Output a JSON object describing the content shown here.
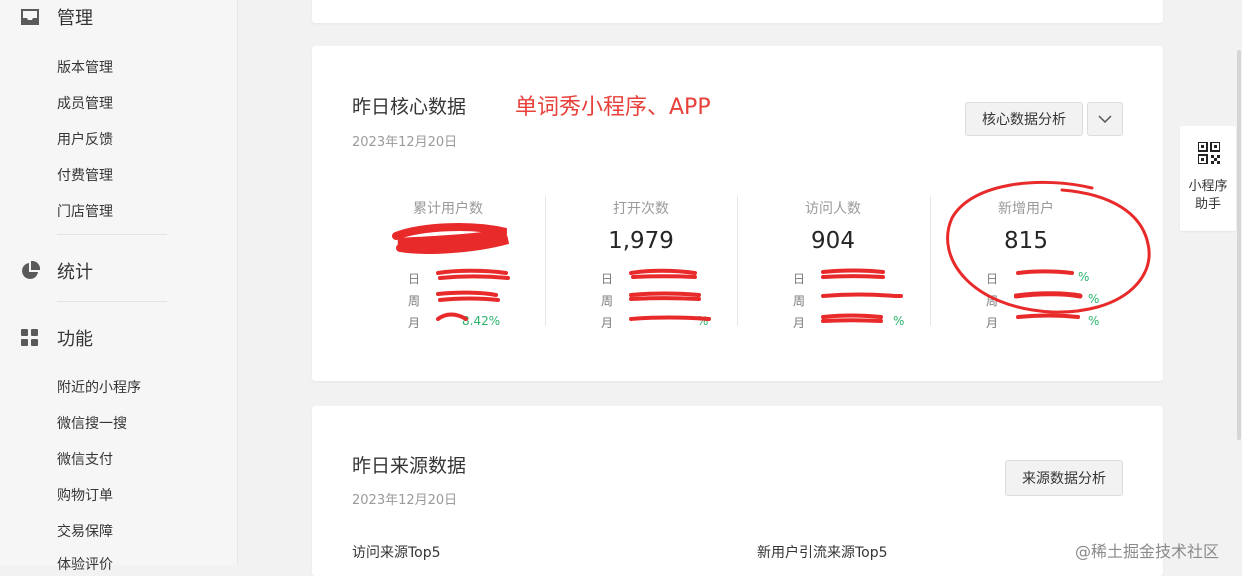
{
  "sidebar": {
    "groups": [
      {
        "label": "管理",
        "icon": "inbox-icon"
      },
      {
        "label": "统计",
        "icon": "pie-chart-icon"
      },
      {
        "label": "功能",
        "icon": "grid-icon"
      }
    ],
    "manage_items": [
      "版本管理",
      "成员管理",
      "用户反馈",
      "付费管理",
      "门店管理"
    ],
    "feature_items": [
      "附近的小程序",
      "微信搜一搜",
      "微信支付",
      "购物订单",
      "交易保障",
      "体验评价"
    ]
  },
  "core": {
    "title": "昨日核心数据",
    "annotation": "单词秀小程序、APP",
    "date": "2023年12月20日",
    "analysis_button": "核心数据分析",
    "dropdown_icon": "chevron-down-icon",
    "compare_labels": [
      "日",
      "周",
      "月"
    ],
    "metrics": [
      {
        "label": "累计用户数",
        "value": "",
        "compare": [
          "",
          "",
          "8.42%"
        ]
      },
      {
        "label": "打开次数",
        "value": "1,979",
        "compare": [
          "",
          "",
          "%"
        ]
      },
      {
        "label": "访问人数",
        "value": "904",
        "compare": [
          "",
          "",
          "%"
        ]
      },
      {
        "label": "新增用户",
        "value": "815",
        "compare": [
          "%",
          "%",
          "%"
        ]
      }
    ]
  },
  "source": {
    "title": "昨日来源数据",
    "date": "2023年12月20日",
    "analysis_button": "来源数据分析",
    "left_sub": "访问来源Top5",
    "right_sub": "新用户引流来源Top5"
  },
  "helper": {
    "label_line1": "小程序",
    "label_line2": "助手",
    "icon": "qr-code-icon"
  },
  "watermark": "@稀土掘金技术社区",
  "colors": {
    "annotation": "#e8403a",
    "positive": "#2bb46e"
  }
}
